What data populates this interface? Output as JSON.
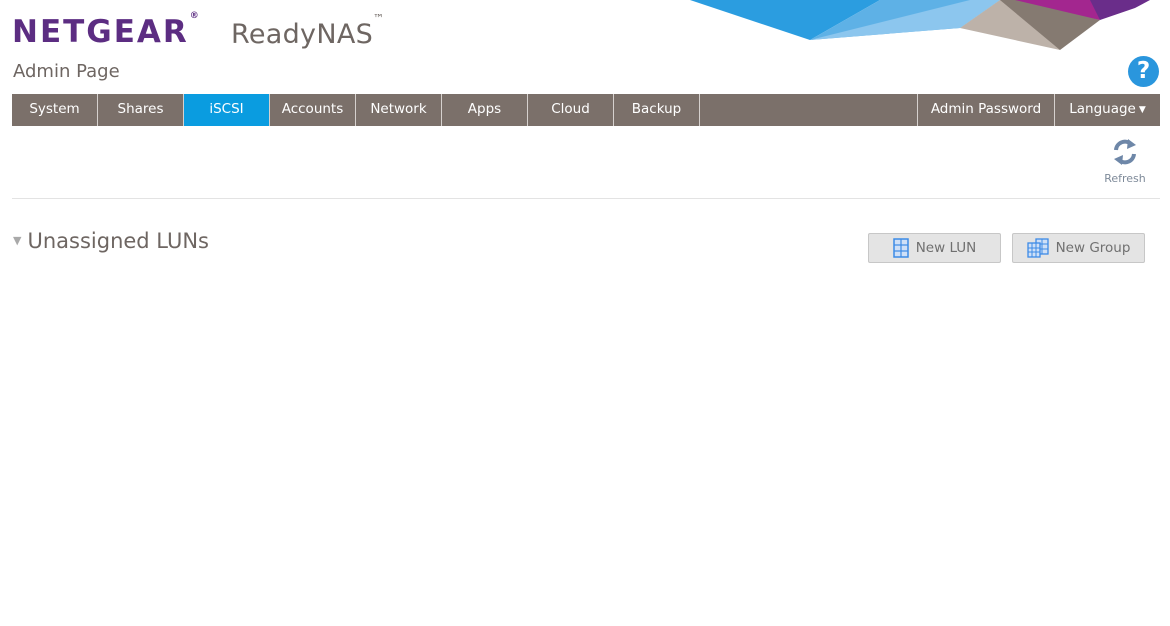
{
  "header": {
    "brand": "NETGEAR",
    "brand_mark": "®",
    "product": "ReadyNAS",
    "product_mark": "™",
    "subtitle": "Admin Page",
    "help_icon": "question-circle-icon",
    "help_symbol": "?"
  },
  "nav": {
    "tabs": [
      {
        "label": "System"
      },
      {
        "label": "Shares"
      },
      {
        "label": "iSCSI",
        "active": true
      },
      {
        "label": "Accounts"
      },
      {
        "label": "Network"
      },
      {
        "label": "Apps"
      },
      {
        "label": "Cloud"
      },
      {
        "label": "Backup"
      }
    ],
    "right": [
      {
        "label": "Admin Password"
      },
      {
        "label": "Language",
        "caret": "▼"
      }
    ]
  },
  "toolbar": {
    "refresh_label": "Refresh",
    "refresh_icon": "refresh-icon"
  },
  "section": {
    "title": "Unassigned LUNs",
    "collapse_symbol": "▼",
    "buttons": {
      "new_lun": {
        "label": "New LUN",
        "icon": "lun-grid-icon"
      },
      "new_group": {
        "label": "New Group",
        "icon": "lun-group-icon"
      }
    }
  },
  "colors": {
    "brand_purple": "#5c2d82",
    "nav_bg": "#7b706a",
    "nav_active": "#0a9ce0",
    "help_blue": "#2a96dd",
    "icon_blue": "#3d8be6"
  }
}
